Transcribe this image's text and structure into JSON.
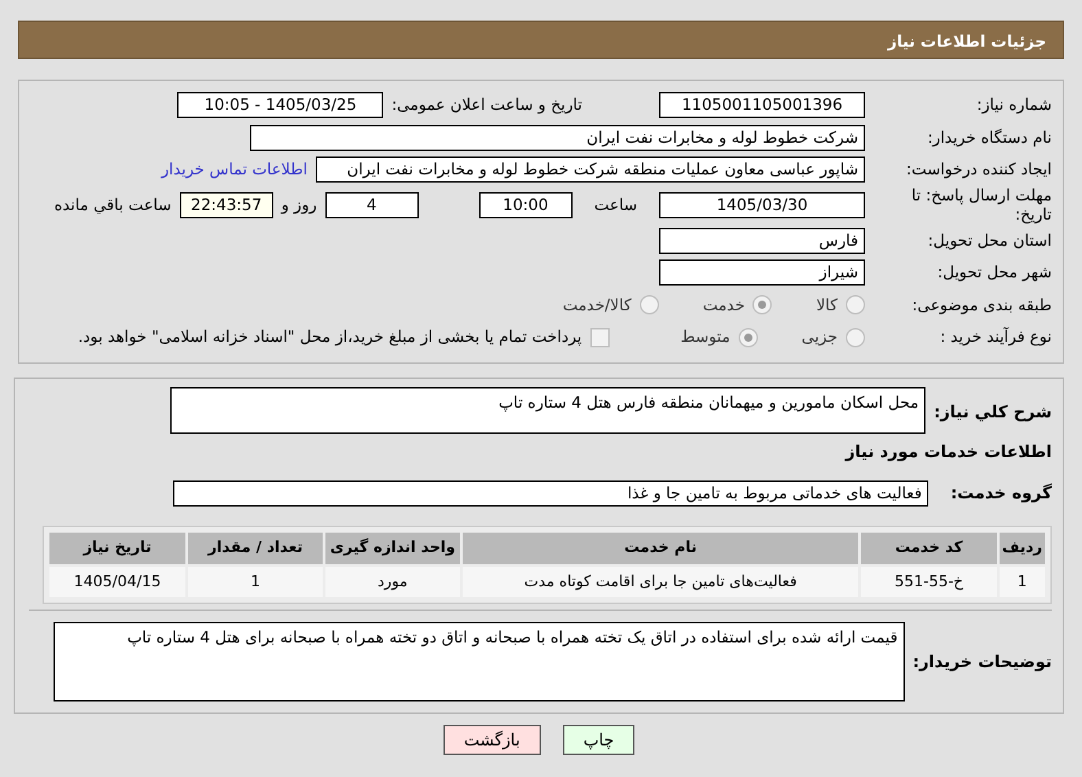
{
  "header": {
    "title": "جزئیات اطلاعات نیاز"
  },
  "details": {
    "need_number": {
      "label": "شماره نیاز:",
      "value": "1105001105001396"
    },
    "announce": {
      "label": "تاریخ و ساعت اعلان عمومی:",
      "value": "1405/03/25 - 10:05"
    },
    "buyer": {
      "label": "نام دستگاه خریدار:",
      "value": "شرکت خطوط لوله و مخابرات نفت ایران"
    },
    "requester": {
      "label": "ایجاد کننده درخواست:",
      "value": "شاپور  عباسی معاون عملیات منطقه شرکت خطوط لوله و مخابرات نفت ایران",
      "link": "اطلاعات تماس خریدار"
    },
    "deadline": {
      "label": "مهلت ارسال پاسخ: تا تاریخ:",
      "date": "1405/03/30",
      "time_label": "ساعت",
      "time": "10:00",
      "days": "4",
      "days_label": "روز و",
      "remaining": "22:43:57",
      "remaining_label": "ساعت باقي مانده"
    },
    "province": {
      "label": "استان محل تحویل:",
      "value": "فارس"
    },
    "city": {
      "label": "شهر محل تحویل:",
      "value": "شیراز"
    },
    "category": {
      "label": "طبقه بندی موضوعی:",
      "options": [
        {
          "label": "کالا",
          "selected": false
        },
        {
          "label": "خدمت",
          "selected": true
        },
        {
          "label": "کالا/خدمت",
          "selected": false
        }
      ]
    },
    "process": {
      "label": "نوع فرآیند خرید :",
      "options": [
        {
          "label": "جزیی",
          "selected": false
        },
        {
          "label": "متوسط",
          "selected": true
        }
      ],
      "treasury": {
        "checked": false,
        "label": "پرداخت تمام یا بخشی از مبلغ خرید،از محل \"اسناد خزانه اسلامی\" خواهد بود."
      }
    }
  },
  "services": {
    "summary": {
      "label": "شرح کلي نیاز:",
      "value": "محل اسکان مامورین و میهمانان منطقه فارس هتل 4 ستاره تاپ"
    },
    "section_title": "اطلاعات خدمات مورد نیاز",
    "group": {
      "label": "گروه خدمت:",
      "value": "فعالیت های خدماتی مربوط به تامین جا و غذا"
    },
    "table": {
      "columns": [
        "ردیف",
        "کد خدمت",
        "نام خدمت",
        "واحد اندازه گیری",
        "تعداد / مقدار",
        "تاریخ نیاز"
      ],
      "rows": [
        [
          "1",
          "خ-55-551",
          "فعالیت‌های تامین جا برای اقامت کوتاه مدت",
          "مورد",
          "1",
          "1405/04/15"
        ]
      ]
    },
    "notes": {
      "label": "توضیحات خریدار:",
      "value": "قیمت ارائه شده برای استفاده در اتاق یک تخته همراه با صبحانه و اتاق دو تخته همراه با صبحانه برای هتل 4 ستاره تاپ"
    }
  },
  "buttons": [
    {
      "label": "چاپ",
      "kind": "print"
    },
    {
      "label": "بازگشت",
      "kind": "back"
    }
  ]
}
